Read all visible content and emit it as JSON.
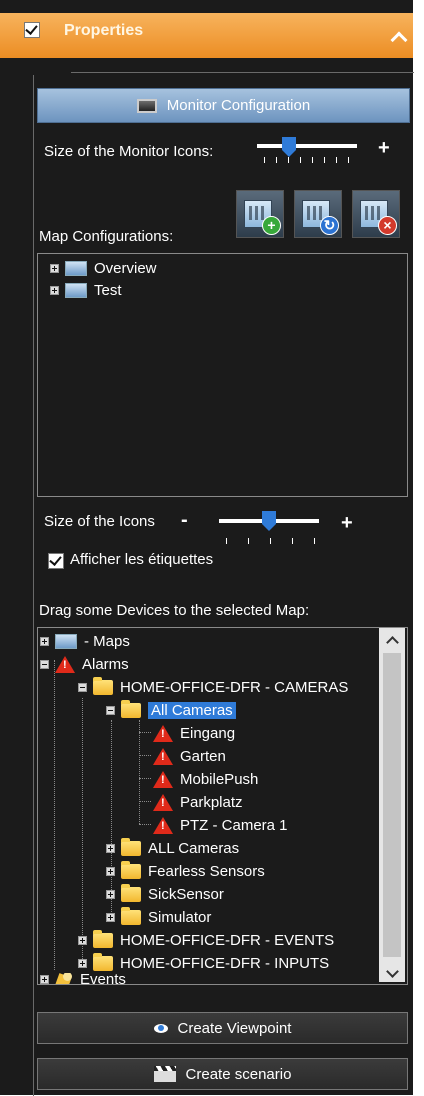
{
  "titlebar": {
    "title": "Properties"
  },
  "monitor": {
    "header": "Monitor Configuration",
    "size_label": "Size of the Monitor Icons:",
    "size_level": 0.3
  },
  "map_configs": {
    "label": "Map Configurations:",
    "buttons": [
      {
        "icon": "add-map-config-icon"
      },
      {
        "icon": "edit-map-config-icon"
      },
      {
        "icon": "delete-map-config-icon"
      }
    ],
    "items": [
      "Overview",
      "Test"
    ]
  },
  "icons": {
    "size_label": "Size of the Icons",
    "size_level": 0.5,
    "show_labels": "Afficher les étiquettes"
  },
  "devices": {
    "label": "Drag some Devices to the selected Map:",
    "tree": [
      "- Maps",
      "Alarms",
      "HOME-OFFICE-DFR - CAMERAS",
      "All Cameras",
      "Eingang",
      "Garten",
      "MobilePush",
      "Parkplatz",
      "PTZ - Camera 1",
      "ALL Cameras",
      "Fearless Sensors",
      "SickSensor",
      "Simulator",
      "HOME-OFFICE-DFR - EVENTS",
      "HOME-OFFICE-DFR - INPUTS",
      "Events"
    ]
  },
  "actions": {
    "create_viewpoint": "Create Viewpoint",
    "create_scenario": "Create scenario"
  },
  "colors": {
    "accent": "#ec8d23",
    "selection": "#2f7bd8",
    "background": "#1b1b1b"
  }
}
